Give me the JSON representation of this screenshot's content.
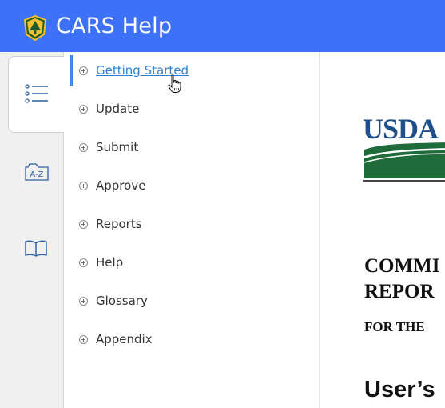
{
  "app": {
    "title": "CARS Help",
    "logo_icon": "forest-service-shield-icon",
    "header_color": "#3d72f8"
  },
  "sidebar_rail": {
    "tabs": [
      {
        "name": "contents",
        "icon": "list-icon",
        "active": true
      },
      {
        "name": "index",
        "icon": "a-z-index-icon",
        "label": "A-Z",
        "active": false
      },
      {
        "name": "glossary",
        "icon": "book-icon",
        "active": false
      }
    ]
  },
  "toc": {
    "items": [
      {
        "label": "Getting Started",
        "selected": true
      },
      {
        "label": "Update"
      },
      {
        "label": "Submit"
      },
      {
        "label": "Approve"
      },
      {
        "label": "Reports"
      },
      {
        "label": "Help"
      },
      {
        "label": "Glossary"
      },
      {
        "label": "Appendix"
      }
    ],
    "accent_color": "#3d86ee"
  },
  "content": {
    "logo_text": "USDA",
    "title_line1": "COMMI",
    "title_line2": "REPOR",
    "subtitle": "FOR THE",
    "guide": "User’s"
  }
}
